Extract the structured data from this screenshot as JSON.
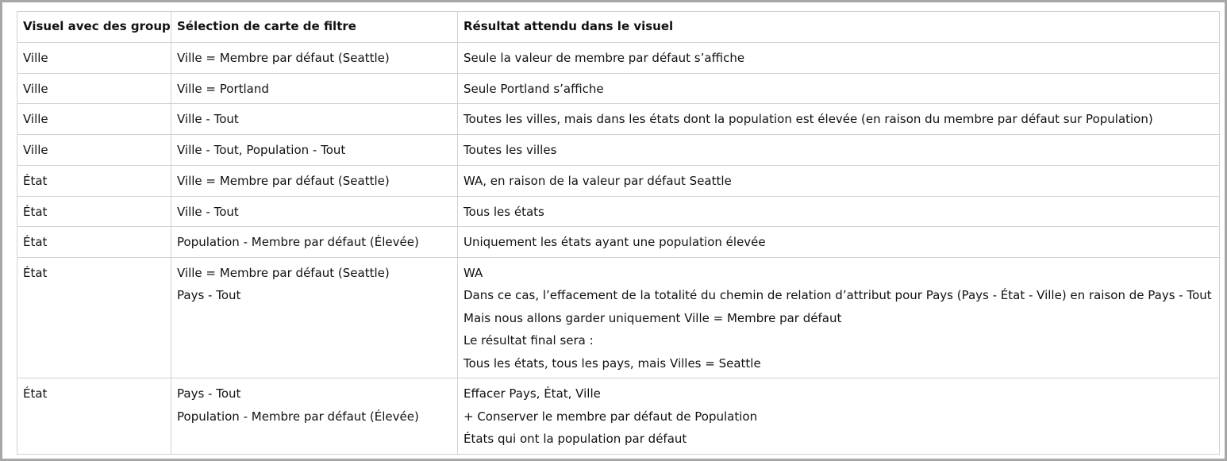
{
  "table": {
    "headers": [
      "Visuel avec des groupes",
      "Sélection de carte de filtre",
      "Résultat attendu dans le visuel"
    ],
    "rows": [
      {
        "visual": "Ville",
        "filter": [
          "Ville = Membre par défaut (Seattle)"
        ],
        "result": [
          "Seule la valeur de membre par défaut s’affiche"
        ]
      },
      {
        "visual": "Ville",
        "filter": [
          "Ville = Portland"
        ],
        "result": [
          "Seule Portland s’affiche"
        ]
      },
      {
        "visual": "Ville",
        "filter": [
          "Ville - Tout"
        ],
        "result": [
          "Toutes les villes, mais dans les états dont la population est élevée (en raison du membre par défaut sur Population)"
        ]
      },
      {
        "visual": "Ville",
        "filter": [
          "Ville - Tout, Population - Tout"
        ],
        "result": [
          "Toutes les villes"
        ]
      },
      {
        "visual": "État",
        "filter": [
          "Ville = Membre par défaut (Seattle)"
        ],
        "result": [
          "WA, en raison de la valeur par défaut Seattle"
        ]
      },
      {
        "visual": "État",
        "filter": [
          "Ville - Tout"
        ],
        "result": [
          "Tous les états"
        ]
      },
      {
        "visual": "État",
        "filter": [
          "Population - Membre par défaut (Élevée)"
        ],
        "result": [
          "Uniquement les états ayant une population élevée"
        ]
      },
      {
        "visual": "État",
        "filter": [
          "Ville = Membre par défaut (Seattle)",
          "Pays - Tout"
        ],
        "result": [
          "WA",
          "Dans ce cas, l’effacement de la totalité du chemin de relation d’attribut pour Pays (Pays - État - Ville) en raison de Pays - Tout",
          "Mais nous allons garder uniquement Ville = Membre par défaut",
          "Le résultat final sera :",
          "Tous les états, tous les pays, mais Villes = Seattle"
        ]
      },
      {
        "visual": "État",
        "filter": [
          "Pays - Tout",
          "Population - Membre par défaut (Élevée)"
        ],
        "result": [
          "Effacer Pays, État, Ville",
          "+ Conserver le membre par défaut de Population",
          "États qui ont la population par défaut"
        ]
      }
    ]
  }
}
